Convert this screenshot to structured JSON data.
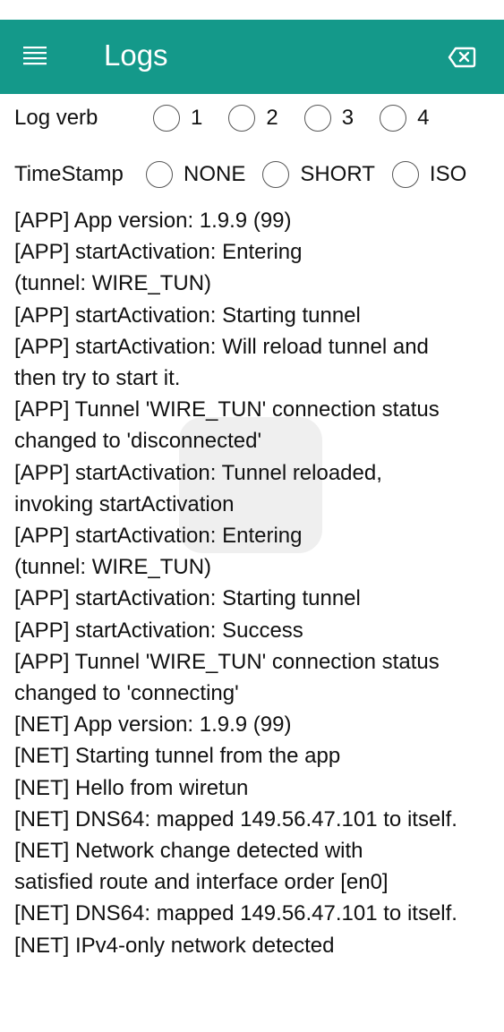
{
  "header": {
    "title": "Logs",
    "menu_icon": "hamburger-menu-icon",
    "clear_icon": "backspace-clear-icon",
    "bar_color": "#14998a"
  },
  "log_verb": {
    "label": "Log verb",
    "options": [
      "1",
      "2",
      "3",
      "4"
    ],
    "selected": null
  },
  "timestamp": {
    "label": "TimeStamp",
    "options": [
      "NONE",
      "SHORT",
      "ISO"
    ],
    "selected": null
  },
  "logs": [
    "[APP] App version: 1.9.9 (99)",
    "[APP] startActivation: Entering",
    "(tunnel: WIRE_TUN)",
    "[APP] startActivation: Starting tunnel",
    "[APP] startActivation: Will reload tunnel and",
    "then try to start it.",
    "[APP] Tunnel 'WIRE_TUN' connection status",
    "changed to 'disconnected'",
    "[APP] startActivation: Tunnel reloaded,",
    "invoking startActivation",
    "[APP] startActivation: Entering",
    "(tunnel: WIRE_TUN)",
    "[APP] startActivation: Starting tunnel",
    "[APP] startActivation: Success",
    "[APP] Tunnel 'WIRE_TUN' connection status",
    "changed to 'connecting'",
    "[NET] App version: 1.9.9 (99)",
    "[NET] Starting tunnel from the app",
    "[NET] Hello from wiretun",
    "[NET] DNS64: mapped 149.56.47.101 to itself.",
    "[NET] Network change detected with",
    "satisfied route and interface order [en0]",
    "[NET] DNS64: mapped 149.56.47.101 to itself.",
    "[NET] IPv4-only network detected"
  ]
}
